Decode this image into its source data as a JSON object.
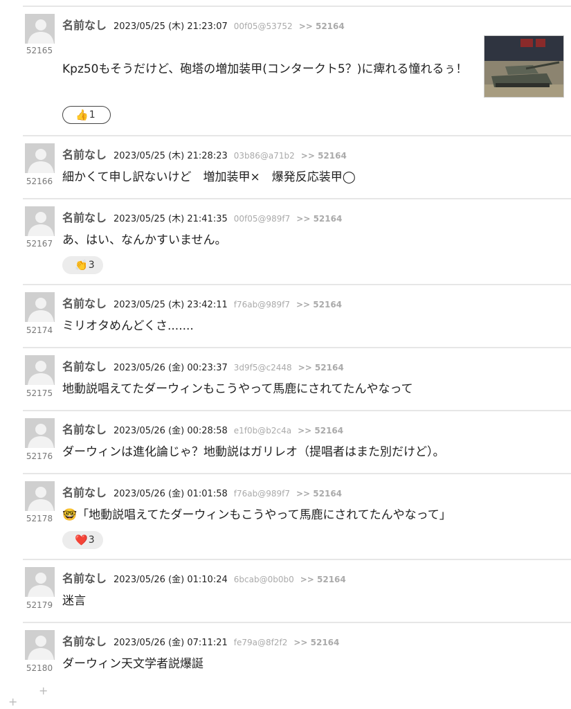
{
  "posts": [
    {
      "num": "52165",
      "name": "名前なし",
      "date": "2023/05/25 (木) 21:23:07",
      "uid": "00f05@53752",
      "reply": ">> 52164",
      "body": "Kpz50もそうだけど、砲塔の増加装甲(コンタークト5？)に痺れる憧れるぅ！",
      "reaction": {
        "emoji": "👍",
        "count": "1",
        "icon": "thumbs-up-icon"
      },
      "has_image": true
    },
    {
      "num": "52166",
      "name": "名前なし",
      "date": "2023/05/25 (木) 21:28:23",
      "uid": "03b86@a71b2",
      "reply": ">> 52164",
      "body": "細かくて申し訳ないけど　増加装甲×　爆発反応装甲◯"
    },
    {
      "num": "52167",
      "name": "名前なし",
      "date": "2023/05/25 (木) 21:41:35",
      "uid": "00f05@989f7",
      "reply": ">> 52164",
      "body": "あ、はい、なんかすいません。",
      "reaction": {
        "emoji": "👏",
        "count": "3",
        "icon": "clap-icon"
      }
    },
    {
      "num": "52174",
      "name": "名前なし",
      "date": "2023/05/25 (木) 23:42:11",
      "uid": "f76ab@989f7",
      "reply": ">> 52164",
      "body": "ミリオタめんどくさ......."
    },
    {
      "num": "52175",
      "name": "名前なし",
      "date": "2023/05/26 (金) 00:23:37",
      "uid": "3d9f5@c2448",
      "reply": ">> 52164",
      "body": "地動説唱えてたダーウィンもこうやって馬鹿にされてたんやなって"
    },
    {
      "num": "52176",
      "name": "名前なし",
      "date": "2023/05/26 (金) 00:28:58",
      "uid": "e1f0b@b2c4a",
      "reply": ">> 52164",
      "body": "ダーウィンは進化論じゃ？地動説はガリレオ（提唱者はまた別だけど）。"
    },
    {
      "num": "52178",
      "name": "名前なし",
      "date": "2023/05/26 (金) 01:01:58",
      "uid": "f76ab@989f7",
      "reply": ">> 52164",
      "body": "🤓「地動説唱えてたダーウィンもこうやって馬鹿にされてたんやなって」",
      "reaction": {
        "emoji": "❤️",
        "count": "3",
        "icon": "heart-icon"
      }
    },
    {
      "num": "52179",
      "name": "名前なし",
      "date": "2023/05/26 (金) 01:10:24",
      "uid": "6bcab@0b0b0",
      "reply": ">> 52164",
      "body": "迷言"
    },
    {
      "num": "52180",
      "name": "名前なし",
      "date": "2023/05/26 (金) 07:11:21",
      "uid": "fe79a@8f2f2",
      "reply": ">> 52164",
      "body": "ダーウィン天文学者説爆誕"
    }
  ]
}
